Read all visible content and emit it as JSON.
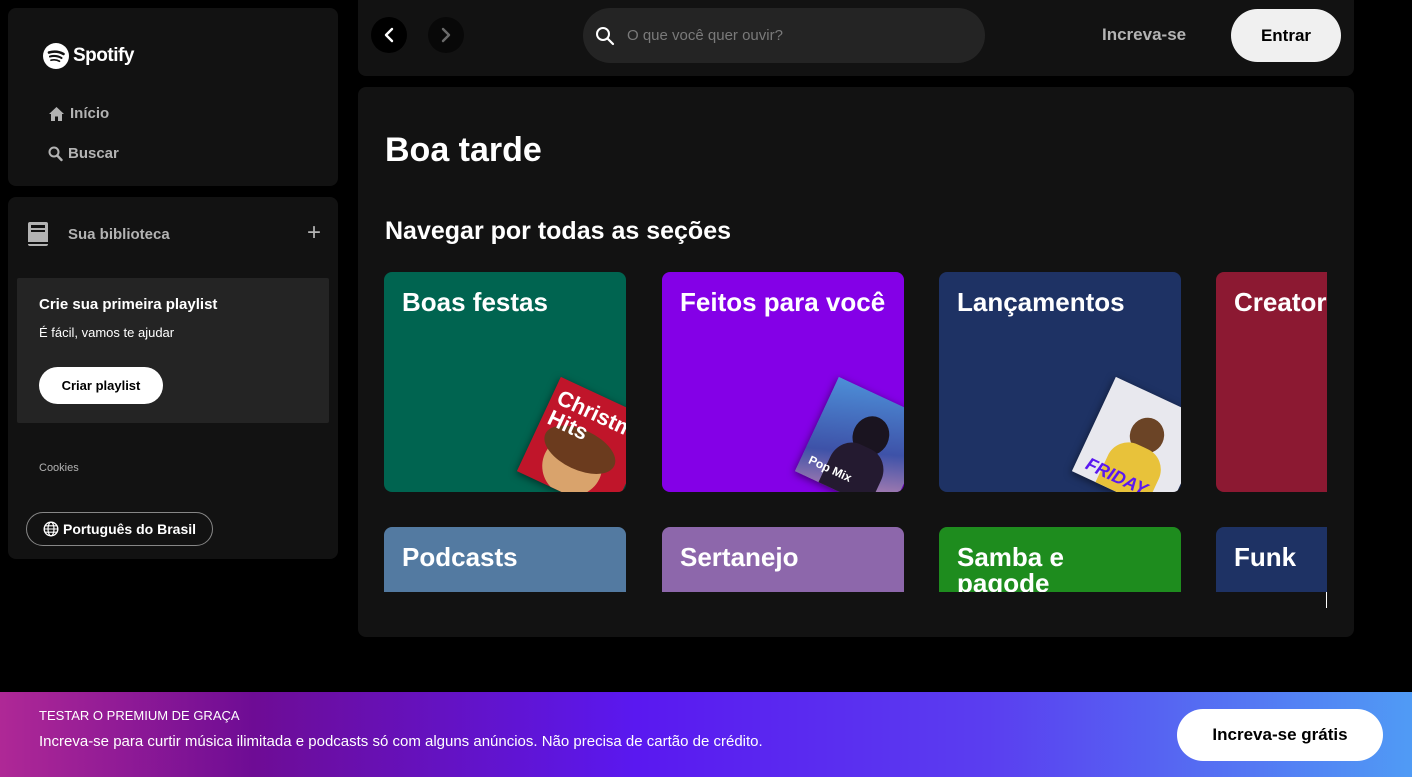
{
  "app": {
    "name": "Spotify"
  },
  "sidebar": {
    "nav": [
      {
        "label": "Início",
        "icon": "home-icon"
      },
      {
        "label": "Buscar",
        "icon": "search-icon"
      }
    ],
    "library": {
      "title": "Sua biblioteca",
      "add_icon": "plus-icon",
      "create_playlist": {
        "title": "Crie sua primeira playlist",
        "subtitle": "É fácil, vamos te ajudar",
        "button": "Criar playlist"
      },
      "cookies": "Cookies",
      "language": "Português do Brasil"
    }
  },
  "topbar": {
    "search_placeholder": "O que você quer ouvir?",
    "signup": "Increva-se",
    "login": "Entrar"
  },
  "main": {
    "greeting": "Boa tarde",
    "section_title": "Navegar por todas as seções",
    "cards": [
      {
        "label": "Boas festas",
        "color": "#006450",
        "art_text": "Christmas Hits",
        "art_color": "#c0152a"
      },
      {
        "label": "Feitos para você",
        "color": "#8400e7",
        "art_text": "Pop Mix",
        "art_color": "#4a6fd1"
      },
      {
        "label": "Lançamentos",
        "color": "#1e3264",
        "art_text": "FRIDAY",
        "art_color": "#e8e8ee"
      },
      {
        "label": "Creators",
        "color": "#8c1932"
      },
      {
        "label": "Podcasts",
        "color": "#537aa1"
      },
      {
        "label": "Sertanejo",
        "color": "#8d67ab"
      },
      {
        "label": "Samba e pagode",
        "color": "#1e8c1e"
      },
      {
        "label": "Funk",
        "color": "#1e3264"
      }
    ]
  },
  "banner": {
    "kicker": "TESTAR O PREMIUM DE GRAÇA",
    "text": "Increva-se para curtir música ilimitada e podcasts só com alguns anúncios. Não precisa de cartão de crédito.",
    "button": "Increva-se grátis"
  }
}
